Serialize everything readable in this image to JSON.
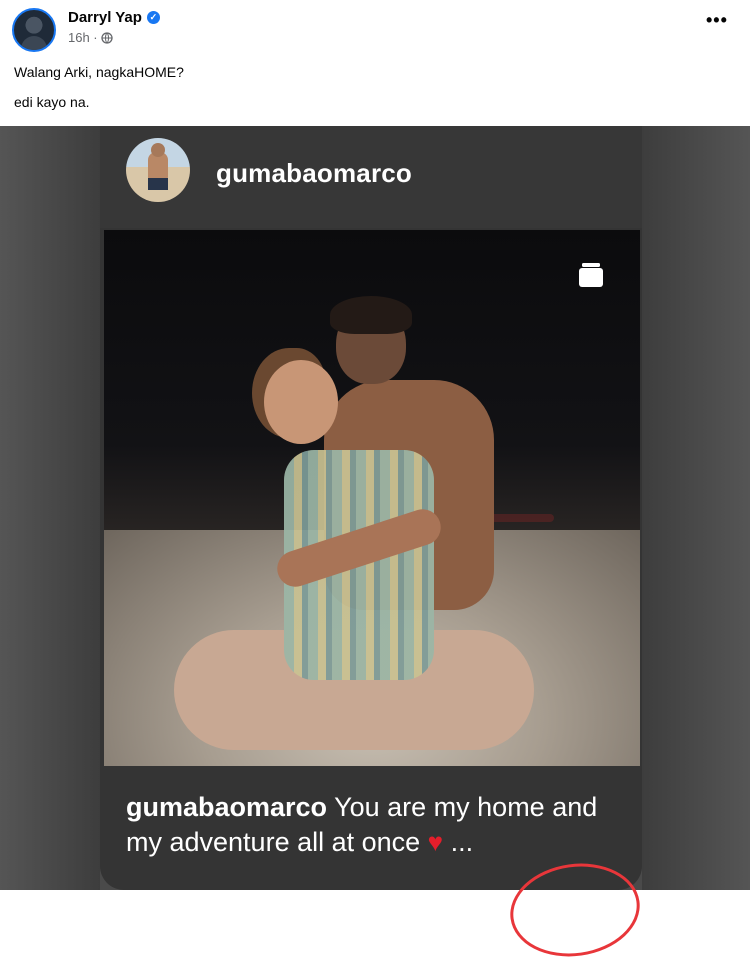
{
  "post": {
    "author": "Darryl Yap",
    "time": "16h ·",
    "caption_line1": "Walang Arki, nagkaHOME?",
    "caption_line2": "edi kayo na.",
    "more": "•••"
  },
  "story": {
    "username": "gumabaomarco",
    "caption_user": "gumabaomarco",
    "caption_text": " You are my home and my adventure all at once ",
    "ellipsis": " ..."
  },
  "icons": [
    "verified-badge-icon",
    "globe-icon",
    "more-options-icon",
    "multiple-photos-icon",
    "heart-icon"
  ],
  "colors": {
    "fb_blue": "#1877f2",
    "ig_card": "#343434",
    "highlight_red": "#e8363a"
  }
}
